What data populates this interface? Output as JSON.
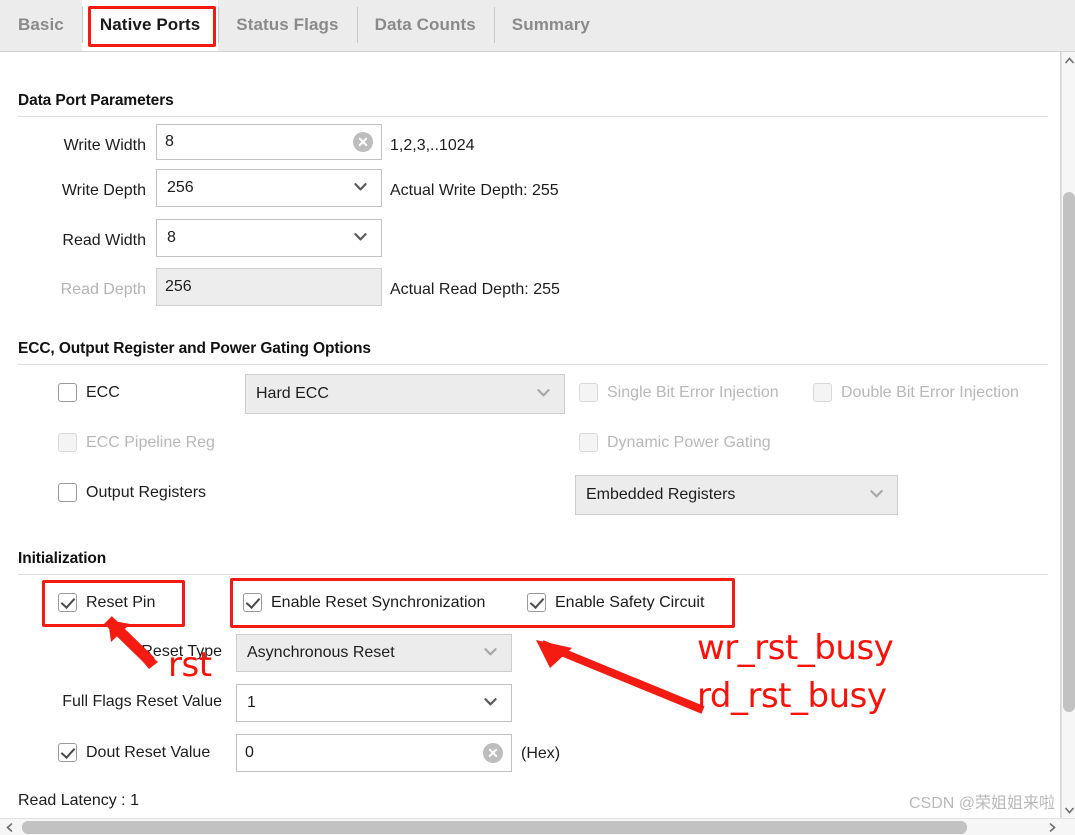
{
  "tabs": [
    {
      "label": "Basic",
      "active": false
    },
    {
      "label": "Native Ports",
      "active": true
    },
    {
      "label": "Status Flags",
      "active": false
    },
    {
      "label": "Data Counts",
      "active": false
    },
    {
      "label": "Summary",
      "active": false
    }
  ],
  "sections": {
    "data_port": {
      "title": "Data Port Parameters",
      "fields": {
        "write_width": {
          "label": "Write Width",
          "value": "8",
          "hint": "1,2,3,..1024"
        },
        "write_depth": {
          "label": "Write Depth",
          "value": "256",
          "hint": "Actual Write Depth: 255"
        },
        "read_width": {
          "label": "Read Width",
          "value": "8",
          "hint": ""
        },
        "read_depth": {
          "label": "Read Depth",
          "value": "256",
          "hint": "Actual Read Depth: 255"
        }
      }
    },
    "ecc": {
      "title": "ECC, Output Register and Power Gating Options",
      "ecc_checkbox": {
        "label": "ECC",
        "checked": false,
        "enabled": true
      },
      "ecc_mode": {
        "value": "Hard ECC",
        "enabled": false
      },
      "single_bit": {
        "label": "Single Bit Error Injection",
        "checked": false,
        "enabled": false
      },
      "double_bit": {
        "label": "Double Bit Error Injection",
        "checked": false,
        "enabled": false
      },
      "ecc_pipeline": {
        "label": "ECC Pipeline Reg",
        "checked": false,
        "enabled": false
      },
      "dynamic_power_gating": {
        "label": "Dynamic Power Gating",
        "checked": false,
        "enabled": false
      },
      "output_registers": {
        "label": "Output Registers",
        "checked": false,
        "enabled": true
      },
      "register_mode": {
        "value": "Embedded Registers",
        "enabled": false
      }
    },
    "initialization": {
      "title": "Initialization",
      "reset_pin": {
        "label": "Reset Pin",
        "checked": true,
        "enabled": true
      },
      "enable_reset_sync": {
        "label": "Enable Reset Synchronization",
        "checked": true,
        "enabled": true
      },
      "enable_safety_circuit": {
        "label": "Enable Safety Circuit",
        "checked": true,
        "enabled": true
      },
      "reset_type": {
        "label": "Reset Type",
        "value": "Asynchronous Reset",
        "enabled": false
      },
      "full_flags_reset_value": {
        "label": "Full Flags Reset Value",
        "value": "1",
        "enabled": true
      },
      "dout_reset_value": {
        "label": "Dout Reset Value",
        "checked": true,
        "value": "0",
        "suffix": "(Hex)"
      },
      "read_latency": "Read Latency : 1"
    }
  },
  "annotations": {
    "rst": "rst",
    "wr_rst_busy": "wr_rst_busy",
    "rd_rst_busy": "rd_rst_busy",
    "highlight_color": "#f41c12"
  },
  "watermark": "CSDN @荣姐姐来啦"
}
